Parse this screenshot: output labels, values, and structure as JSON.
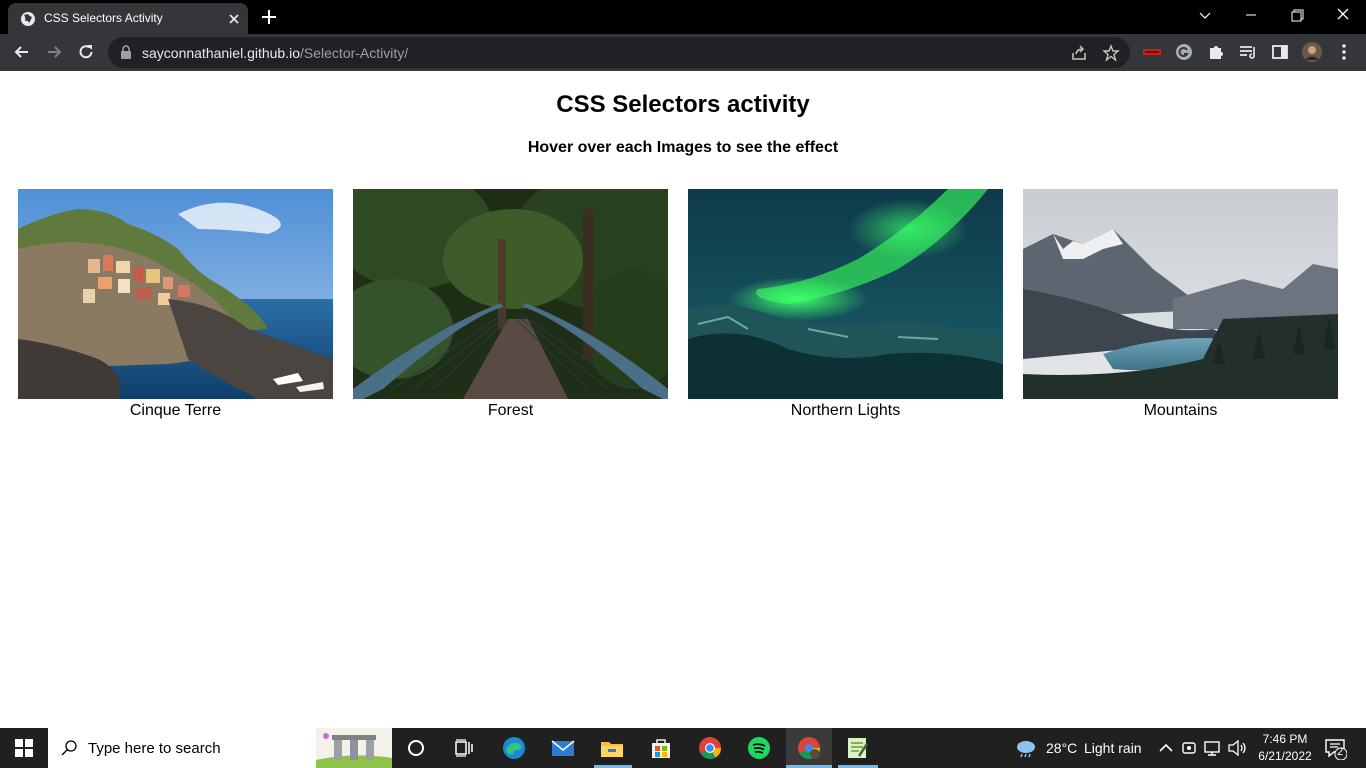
{
  "browser": {
    "tab_title": "CSS Selectors Activity",
    "url_host": "sayconnathaniel.github.io",
    "url_path": "/Selector-Activity/"
  },
  "page": {
    "title": "CSS Selectors activity",
    "subtitle": "Hover over each Images to see the effect",
    "cards": [
      {
        "caption": "Cinque Terre"
      },
      {
        "caption": "Forest"
      },
      {
        "caption": "Northern Lights"
      },
      {
        "caption": "Mountains"
      }
    ]
  },
  "taskbar": {
    "search_placeholder": "Type here to search",
    "weather_temp": "28°C",
    "weather_desc": "Light rain",
    "time": "7:46 PM",
    "date": "6/21/2022",
    "notification_count": "2"
  },
  "icons": {
    "tab_favicon": "globe-icon",
    "back": "arrow-left-icon",
    "forward": "arrow-right-icon",
    "reload": "reload-icon",
    "lock": "lock-icon",
    "share": "share-icon",
    "bookmark": "star-icon",
    "extensions": "puzzle-icon"
  },
  "colors": {
    "tabstrip_bg": "#000000",
    "toolbar_bg": "#35363a",
    "omnibox_bg": "#202124",
    "taskbar_bg": "#202020"
  }
}
